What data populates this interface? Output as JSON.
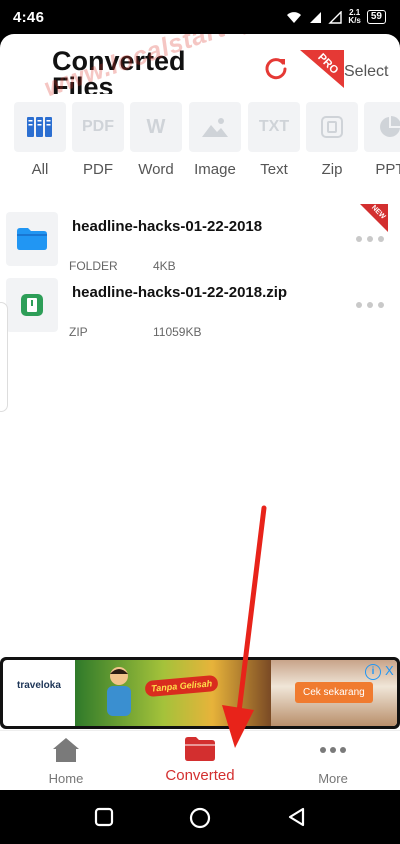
{
  "status_bar": {
    "time": "4:46",
    "net_speed_value": "2.1",
    "net_speed_unit": "K/s",
    "battery": "59"
  },
  "header": {
    "title": "Converted Files",
    "pro_badge": "PRO",
    "select_label": "Select"
  },
  "watermark": "www.localstartupfest.id",
  "tabs": [
    {
      "label": "All",
      "icon": "all-files-icon",
      "selected": true
    },
    {
      "label": "PDF",
      "icon": "pdf-icon",
      "icon_text": "PDF"
    },
    {
      "label": "Word",
      "icon": "word-icon",
      "icon_text": "W"
    },
    {
      "label": "Image",
      "icon": "image-icon"
    },
    {
      "label": "Text",
      "icon": "text-icon",
      "icon_text": "TXT"
    },
    {
      "label": "Zip",
      "icon": "zip-icon"
    },
    {
      "label": "PPT",
      "icon": "ppt-icon"
    }
  ],
  "files": [
    {
      "name": "headline-hacks-01-22-2018",
      "type": "FOLDER",
      "size": "4KB",
      "icon": "folder-icon",
      "new_badge": "NEW"
    },
    {
      "name": "headline-hacks-01-22-2018.zip",
      "type": "ZIP",
      "size": "11059KB",
      "icon": "zip-file-icon"
    }
  ],
  "ad": {
    "brand": "traveloka",
    "tagline": "Tanpa Gelisah",
    "cta": "Cek sekarang",
    "info": "i",
    "close": "X"
  },
  "bottom_nav": [
    {
      "label": "Home",
      "icon": "home-icon"
    },
    {
      "label": "Converted",
      "icon": "folder-icon",
      "active": true
    },
    {
      "label": "More",
      "icon": "more-dots-icon"
    }
  ],
  "colors": {
    "accent_red": "#d32f2f",
    "tile_bg": "#f2f3f5",
    "folder_blue": "#2196f3",
    "zip_green": "#2e9e58",
    "annotation_red": "#e8231a"
  }
}
